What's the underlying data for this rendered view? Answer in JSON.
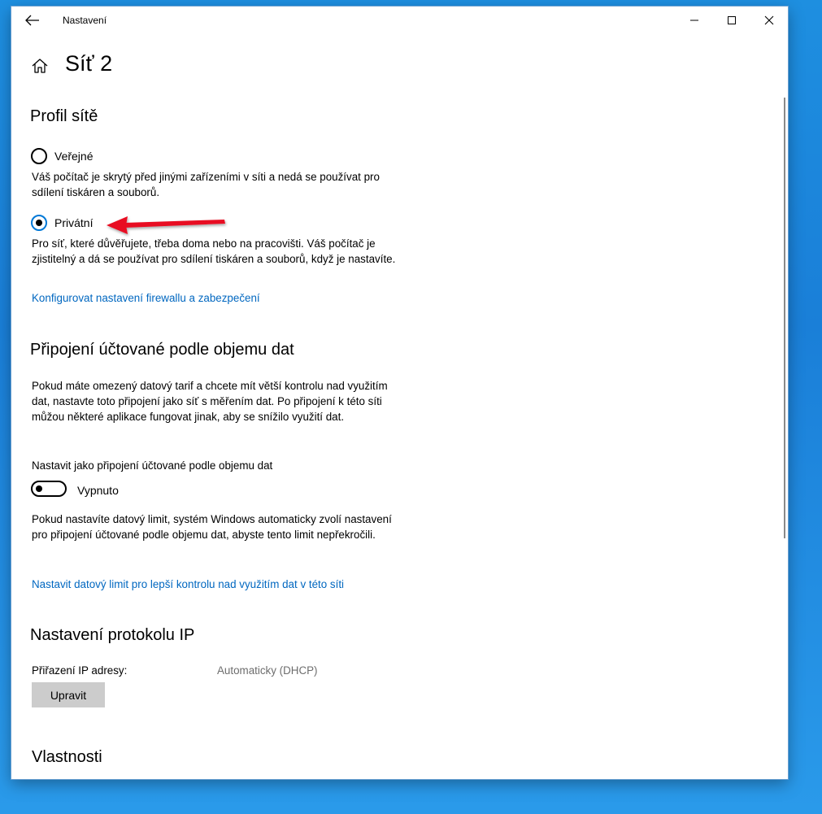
{
  "window": {
    "title": "Nastavení"
  },
  "page": {
    "title": "Síť 2"
  },
  "profile": {
    "heading": "Profil sítě",
    "public": {
      "label": "Veřejné",
      "description": "Váš počítač je skrytý před jinými zařízeními v síti a nedá se používat pro sdílení tiskáren a souborů.",
      "checked": false
    },
    "private": {
      "label": "Privátní",
      "description": "Pro síť, které důvěřujete, třeba doma nebo na pracovišti. Váš počítač je zjistitelný a dá se používat pro sdílení tiskáren a souborů, když je nastavíte.",
      "checked": true
    },
    "firewall_link": "Konfigurovat nastavení firewallu a zabezpečení"
  },
  "metered": {
    "heading": "Připojení účtované podle objemu dat",
    "description": "Pokud máte omezený datový tarif a chcete mít větší kontrolu nad využitím dat, nastavte toto připojení jako síť s měřením dat. Po připojení k této síti můžou některé aplikace fungovat jinak, aby se snížilo využití dat.",
    "toggle_label": "Nastavit jako připojení účtované podle objemu dat",
    "toggle_state": "Vypnuto",
    "limit_description": "Pokud nastavíte datový limit, systém Windows automaticky zvolí nastavení pro připojení účtované podle objemu dat, abyste tento limit nepřekročili.",
    "limit_link": "Nastavit datový limit pro lepší kontrolu nad využitím dat v této síti"
  },
  "ip": {
    "heading": "Nastavení protokolu IP",
    "assignment_label": "Přiřazení IP adresy:",
    "assignment_value": "Automaticky (DHCP)",
    "edit_button": "Upravit"
  },
  "properties": {
    "heading": "Vlastnosti"
  },
  "colors": {
    "accent": "#0078d7",
    "link": "#0067c0",
    "arrow": "#e81123",
    "desktop": "#1a7fd8"
  }
}
